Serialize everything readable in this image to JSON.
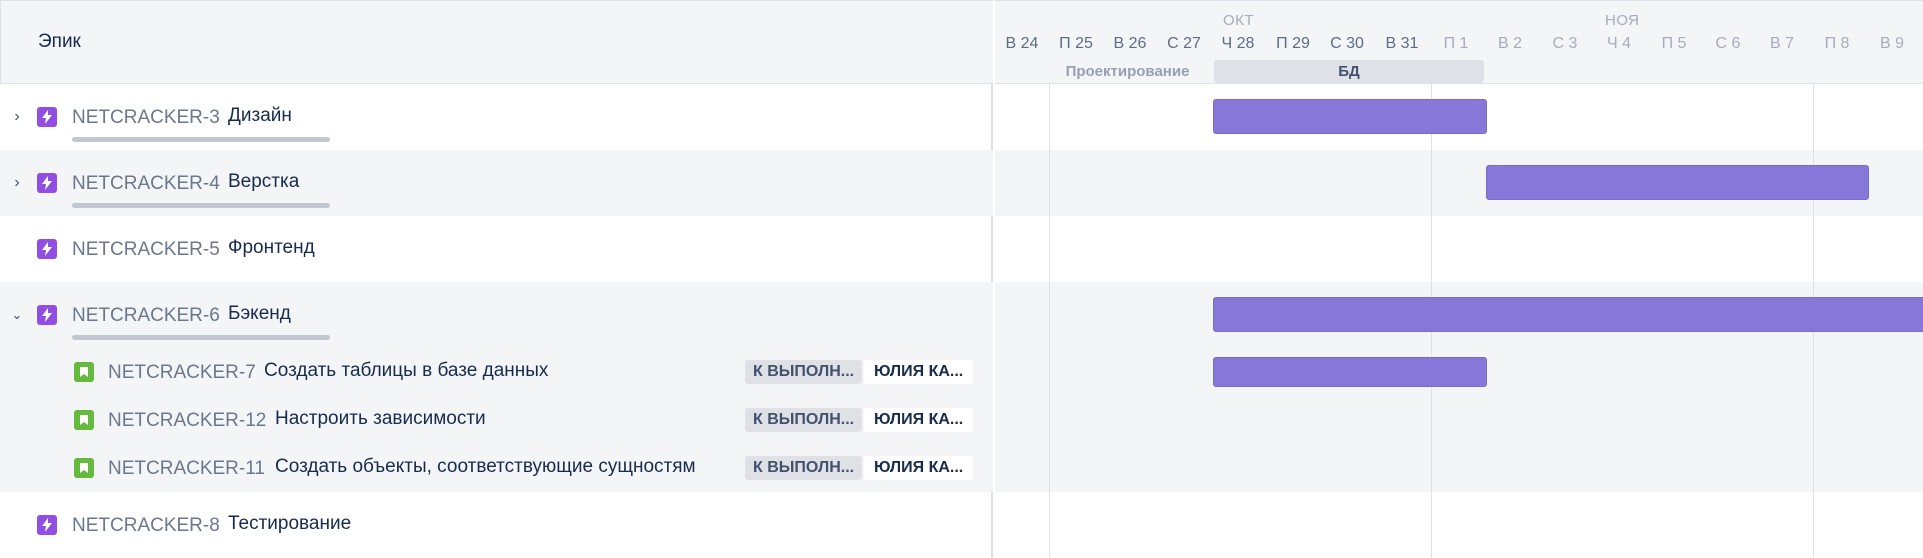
{
  "header": {
    "epic_label": "Эпик"
  },
  "timeline": {
    "months": [
      "ОКТ",
      "НОЯ"
    ],
    "days": [
      "В 24",
      "П 25",
      "В 26",
      "С 27",
      "Ч 28",
      "П 29",
      "С 30",
      "В 31",
      "П 1",
      "В 2",
      "С 3",
      "Ч 4",
      "П 5",
      "С 6",
      "В 7",
      "П 8",
      "В 9"
    ],
    "releases": [
      "Проектирование",
      "БД"
    ]
  },
  "rows": [
    {
      "key": "NETCRACKER-3",
      "summary": "Дизайн",
      "expandable": "collapsed"
    },
    {
      "key": "NETCRACKER-4",
      "summary": "Верстка",
      "expandable": "collapsed"
    },
    {
      "key": "NETCRACKER-5",
      "summary": "Фронтенд",
      "expandable": "none"
    },
    {
      "key": "NETCRACKER-6",
      "summary": "Бэкенд",
      "expandable": "expanded"
    },
    {
      "key": "NETCRACKER-7",
      "summary": "Создать таблицы в базе данных",
      "status": "К ВЫПОЛН...",
      "assignee": "ЮЛИЯ КА..."
    },
    {
      "key": "NETCRACKER-12",
      "summary": "Настроить зависимости",
      "status": "К ВЫПОЛН...",
      "assignee": "ЮЛИЯ КА..."
    },
    {
      "key": "NETCRACKER-11",
      "summary": "Создать объекты, соответствующие сущностям",
      "status": "К ВЫПОЛН...",
      "assignee": "ЮЛИЯ КА..."
    },
    {
      "key": "NETCRACKER-8",
      "summary": "Тестирование",
      "expandable": "none"
    }
  ],
  "colors": {
    "epic": "#904ee2",
    "story": "#63ba3c",
    "bar": "#8777d9"
  }
}
